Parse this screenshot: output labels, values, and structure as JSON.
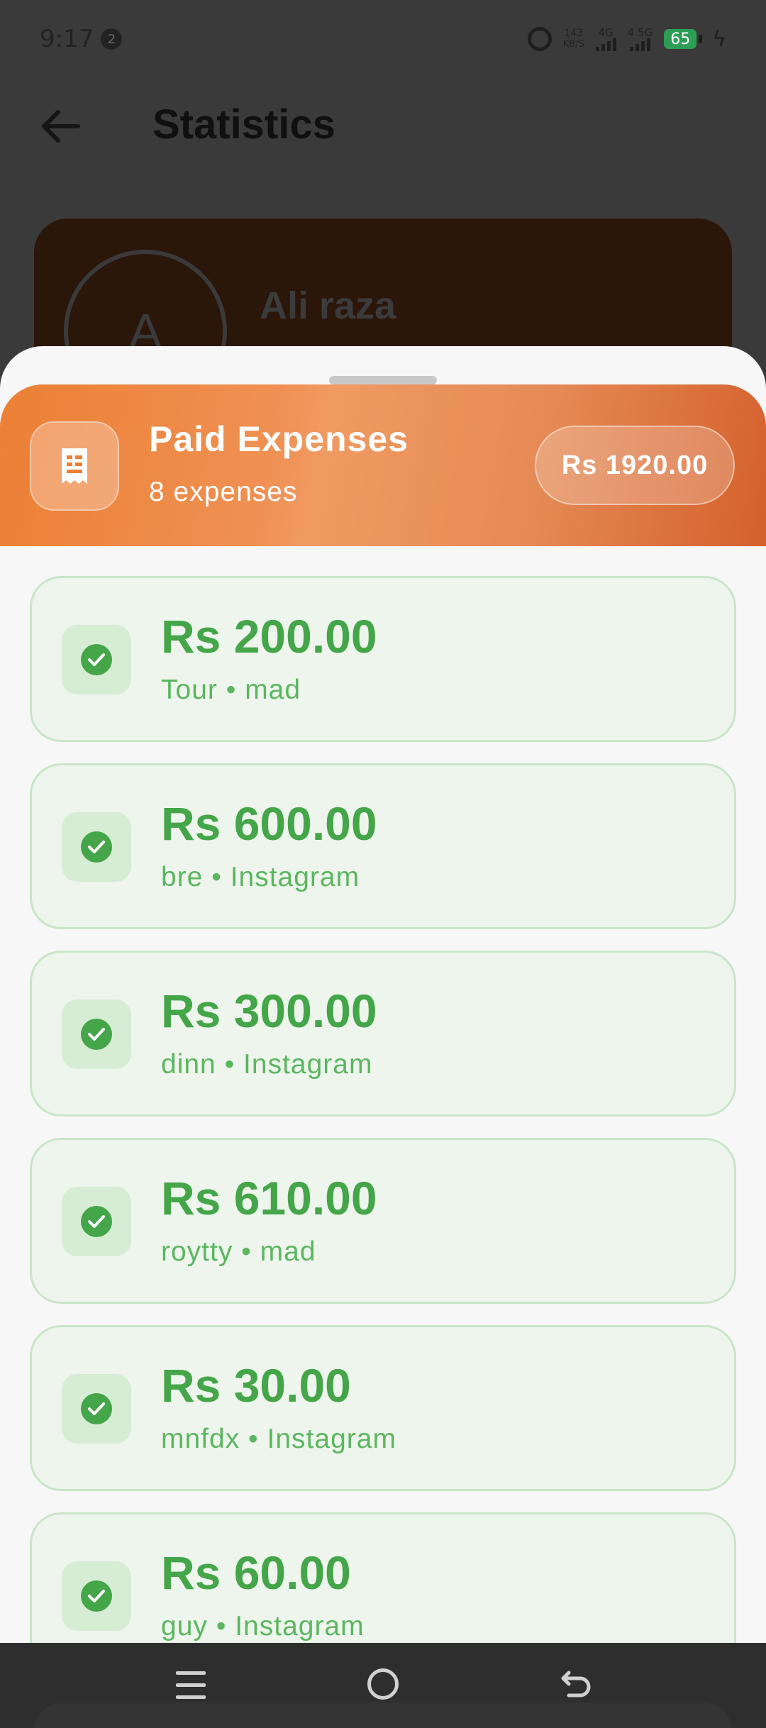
{
  "status_bar": {
    "time": "9:17",
    "notification_count": "2",
    "net_speed_value": "143",
    "net_speed_unit": "KB/S",
    "sim1_label": "4G",
    "sim2_label": "4.5G",
    "battery_level": "65"
  },
  "header": {
    "title": "Statistics"
  },
  "profile": {
    "avatar_letter": "A",
    "name": "Ali raza"
  },
  "sheet": {
    "title": "Paid Expenses",
    "subtitle": "8 expenses",
    "total": "Rs 1920.00",
    "accent_color": "#ec8035"
  },
  "expenses": [
    {
      "amount": "Rs 200.00",
      "meta": "Tour • mad"
    },
    {
      "amount": "Rs 600.00",
      "meta": "bre • Instagram"
    },
    {
      "amount": "Rs 300.00",
      "meta": "dinn • Instagram"
    },
    {
      "amount": "Rs 610.00",
      "meta": "roytty • mad"
    },
    {
      "amount": "Rs 30.00",
      "meta": "mnfdx • Instagram"
    },
    {
      "amount": "Rs 60.00",
      "meta": "guy • Instagram"
    }
  ],
  "status_color": "#45a549"
}
